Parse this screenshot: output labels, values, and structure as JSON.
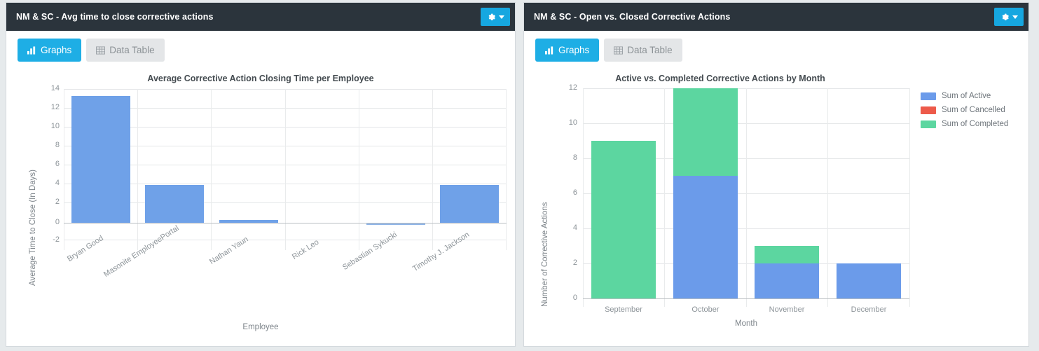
{
  "panels": [
    {
      "title": "NM & SC - Avg time to close corrective actions",
      "gear_icon": "gear-icon",
      "caret_icon": "chevron-down-icon",
      "tabs": [
        {
          "label": "Graphs",
          "icon": "bar-chart-icon",
          "active": true
        },
        {
          "label": "Data Table",
          "icon": "table-icon",
          "active": false
        }
      ]
    },
    {
      "title": "NM & SC - Open vs. Closed Corrective Actions",
      "gear_icon": "gear-icon",
      "caret_icon": "chevron-down-icon",
      "tabs": [
        {
          "label": "Graphs",
          "icon": "bar-chart-icon",
          "active": true
        },
        {
          "label": "Data Table",
          "icon": "table-icon",
          "active": false
        }
      ]
    }
  ],
  "chart_data": [
    {
      "type": "bar",
      "title": "Average Corrective Action Closing Time per Employee",
      "xlabel": "Employee",
      "ylabel": "Average Time to Close (In Days)",
      "categories": [
        "Bryan Good",
        "Masonite EmployeePortal",
        "Nathan Yaun",
        "Rick Leo",
        "Sebastian Sykucki",
        "Timothy J. Jackson"
      ],
      "values": [
        13.5,
        4,
        0.3,
        0,
        -0.1,
        4
      ],
      "ylim": [
        -2,
        14
      ],
      "yticks": [
        14,
        12,
        10,
        8,
        6,
        4,
        2,
        0,
        -2
      ],
      "grid": true,
      "legend": "none",
      "bar_color": "#6fa1e8"
    },
    {
      "type": "bar",
      "subtype": "stacked",
      "title": "Active vs. Completed Corrective Actions by Month",
      "xlabel": "Month",
      "ylabel": "Number of Corrective Actions",
      "categories": [
        "September",
        "October",
        "November",
        "December"
      ],
      "series": [
        {
          "name": "Sum of Active",
          "color": "#6b9bea",
          "values": [
            0,
            7,
            2,
            2
          ]
        },
        {
          "name": "Sum of Cancelled",
          "color": "#ed5a4a",
          "values": [
            0,
            0,
            0,
            0
          ]
        },
        {
          "name": "Sum of Completed",
          "color": "#5cd6a0",
          "values": [
            9,
            5,
            1,
            0
          ]
        }
      ],
      "totals": [
        9,
        12,
        3,
        2
      ],
      "ylim": [
        0,
        12
      ],
      "yticks": [
        12,
        10,
        8,
        6,
        4,
        2,
        0
      ],
      "grid": true,
      "legend": "right"
    }
  ]
}
